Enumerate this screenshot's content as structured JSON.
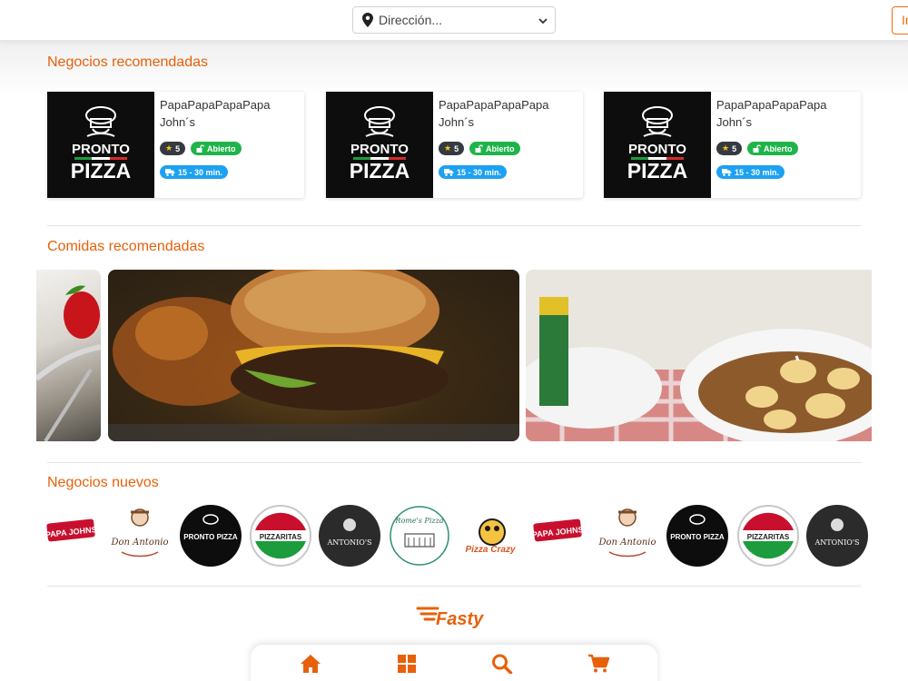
{
  "header": {
    "address_placeholder": "Dirección...",
    "login_label": "In"
  },
  "sections": {
    "recommended_businesses": "Negocios recomendadas",
    "recommended_foods": "Comidas recomendadas",
    "new_businesses": "Negocios nuevos"
  },
  "businesses": [
    {
      "name": "PapaPapaPapaPapa John´s",
      "rating": "5",
      "status": "Abierto",
      "time": "15 - 30 min.",
      "logo_top": "PRONTO",
      "logo_bottom": "PIZZA"
    },
    {
      "name": "PapaPapaPapaPapa John´s",
      "rating": "5",
      "status": "Abierto",
      "time": "15 - 30 min.",
      "logo_top": "PRONTO",
      "logo_bottom": "PIZZA"
    },
    {
      "name": "PapaPapaPapaPapa John´s",
      "rating": "5",
      "status": "Abierto",
      "time": "15 - 30 min.",
      "logo_top": "PRONTO",
      "logo_bottom": "PIZZA"
    }
  ],
  "new_business_logos": [
    {
      "kind": "papa-johns",
      "text": "PAPA JOHNS"
    },
    {
      "kind": "don-antonio",
      "text": "Don Antonio"
    },
    {
      "kind": "pronto-pizza",
      "text": "PRONTO PIZZA"
    },
    {
      "kind": "pizzaritas",
      "text": "PIZZARITAS"
    },
    {
      "kind": "antonios",
      "text": "ANTONIO'S"
    },
    {
      "kind": "romes-pizza",
      "text": "Rome's Pizza"
    },
    {
      "kind": "pizza-crazy",
      "text": "Pizza Crazy"
    },
    {
      "kind": "papa-johns",
      "text": "PAPA JOHNS"
    },
    {
      "kind": "don-antonio",
      "text": "Don Antonio"
    },
    {
      "kind": "pronto-pizza",
      "text": "PRONTO PIZZA"
    },
    {
      "kind": "pizzaritas",
      "text": "PIZZARITAS"
    },
    {
      "kind": "antonios",
      "text": "ANTONIO'S"
    }
  ],
  "footer": {
    "brand": "Fasty"
  },
  "bottom_nav": [
    {
      "icon": "home-icon"
    },
    {
      "icon": "grid-icon"
    },
    {
      "icon": "search-icon"
    },
    {
      "icon": "cart-icon"
    }
  ],
  "colors": {
    "accent": "#e8600a",
    "open": "#1fb44a",
    "time": "#1da1f2",
    "rating": "#343a40"
  }
}
